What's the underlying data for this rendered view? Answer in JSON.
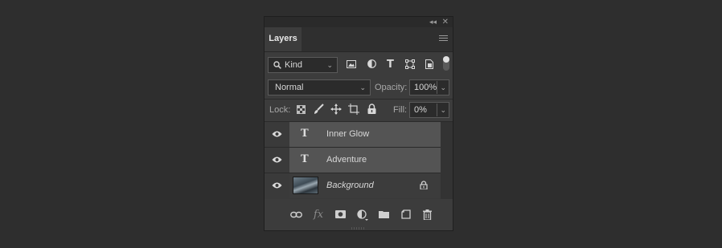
{
  "panel": {
    "collapse_glyph": "◂◂",
    "close_glyph": "✕",
    "tab_label": "Layers",
    "menu_icon": "hamburger-menu-icon"
  },
  "filter": {
    "kind_label": "Kind",
    "icons": [
      "pixel-filter-icon",
      "adjustment-filter-icon",
      "type-filter-icon",
      "shape-filter-icon",
      "smart-object-filter-icon"
    ],
    "toggle_icon": "filter-toggle-icon"
  },
  "blend": {
    "mode": "Normal",
    "opacity_label": "Opacity:",
    "opacity_value": "100%"
  },
  "lock": {
    "label": "Lock:",
    "icons": [
      "lock-transparent-pixels-icon",
      "lock-image-pixels-icon",
      "lock-position-icon",
      "lock-artboard-icon",
      "lock-all-icon"
    ],
    "fill_label": "Fill:",
    "fill_value": "0%"
  },
  "layers": [
    {
      "name": "Inner Glow",
      "type": "text",
      "selected": true,
      "visible": true
    },
    {
      "name": "Adventure",
      "type": "text",
      "selected": true,
      "visible": true
    },
    {
      "name": "Background",
      "type": "image",
      "selected": false,
      "visible": true,
      "locked": true
    }
  ],
  "type_glyph": "T",
  "bottom_bar": {
    "fx_label": "fx",
    "icons": [
      "link-layers-icon",
      "fx-icon",
      "add-mask-icon",
      "new-adjustment-layer-icon",
      "new-group-icon",
      "new-layer-icon",
      "delete-layer-icon"
    ]
  },
  "colors": {
    "panel_bg": "#3c3c3c",
    "selected_layer": "#545454",
    "page_bg": "#2e2e2e"
  }
}
